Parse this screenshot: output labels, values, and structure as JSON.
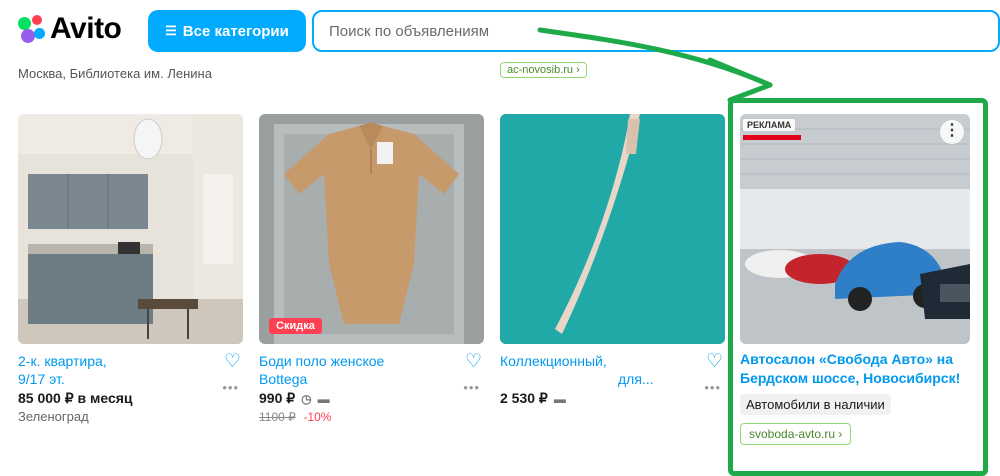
{
  "header": {
    "logo_text": "Avito",
    "categories_button": "Все категории",
    "search_placeholder": "Поиск по объявлениям"
  },
  "location_text": "Москва, Библиотека им. Ленина",
  "top_ad_link": "ac-novosib.ru ›",
  "listings": [
    {
      "title_line1": "2-к. квартира,",
      "title_line2": "9/17 эт.",
      "price": "85 000 ₽ в месяц",
      "location": "Зеленоград"
    },
    {
      "title_line1": "Боди поло женское",
      "title_line2": "Bottega",
      "price": "990 ₽",
      "old_price": "1100 ₽",
      "discount": "-10%",
      "badge": "Скидка"
    },
    {
      "title_line1": "Коллекционный,",
      "title_line2": "для...",
      "price": "2 530 ₽"
    }
  ],
  "ad": {
    "label": "РЕКЛАМА",
    "title": "Автосалон «Свобода Авто» на Бердском шоссе, Новосибирск!",
    "tag": "Автомобили в наличии",
    "link": "svoboda-avto.ru ›"
  },
  "colors": {
    "accent": "#00aaff",
    "link": "#0099ee",
    "highlight_frame": "#1faa4a",
    "sale": "#ff4053"
  }
}
